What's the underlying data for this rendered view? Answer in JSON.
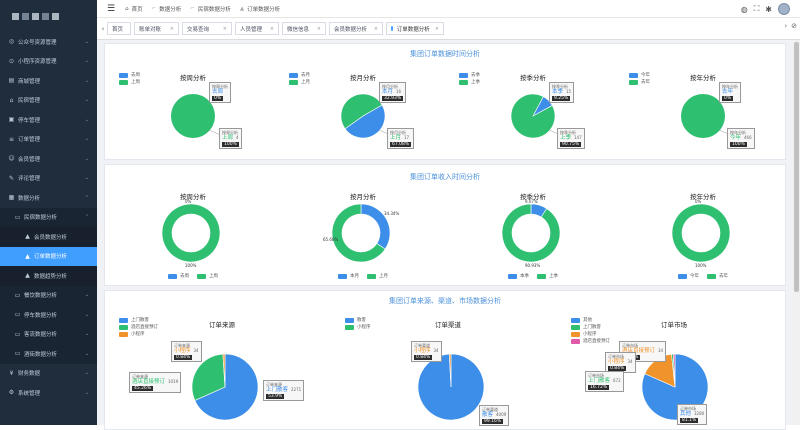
{
  "sidebar": {
    "items": [
      {
        "label": "公众号资源管理",
        "icon": "wechat-icon"
      },
      {
        "label": "小程序资源管理",
        "icon": "miniapp-icon"
      },
      {
        "label": "商城管理",
        "icon": "mall-icon"
      },
      {
        "label": "民宿管理",
        "icon": "homestay-icon"
      },
      {
        "label": "停车管理",
        "icon": "parking-icon"
      },
      {
        "label": "订单管理",
        "icon": "order-icon"
      },
      {
        "label": "会员管理",
        "icon": "member-icon"
      },
      {
        "label": "评论管理",
        "icon": "comment-icon"
      },
      {
        "label": "数据分析",
        "icon": "analysis-icon"
      },
      {
        "label": "民宿数据分析",
        "icon": "folder-icon"
      },
      {
        "label": "会员数据分析",
        "icon": "chart-icon"
      },
      {
        "label": "订单数据分析",
        "icon": "chart-icon"
      },
      {
        "label": "数据趋势分析",
        "icon": "chart-icon"
      },
      {
        "label": "餐饮数据分析",
        "icon": "folder-icon"
      },
      {
        "label": "停车数据分析",
        "icon": "folder-icon"
      },
      {
        "label": "客流数据分析",
        "icon": "folder-icon"
      },
      {
        "label": "酒街数据分析",
        "icon": "folder-icon"
      },
      {
        "label": "财务数据",
        "icon": "finance-icon"
      },
      {
        "label": "系统管理",
        "icon": "system-icon"
      }
    ]
  },
  "navbar": {
    "breadcrumb": [
      "首页",
      "数据分析",
      "民宿数据分析",
      "订单数据分析"
    ]
  },
  "tabs": [
    "首页",
    "账单对账",
    "交易查询",
    "人员管理",
    "微信信息",
    "会员数据分析",
    "订单数据分析"
  ],
  "colors": {
    "blue": "#3d8ee8",
    "green": "#2fbf71",
    "orange": "#f0932b",
    "pink": "#e05aa7",
    "sidebar": "#1f2d3d",
    "accent": "#409eff"
  },
  "sections": {
    "time_title": "集团订单数据时间分析",
    "income_title": "集团订单收入时间分析",
    "source_title": "集团订单来源、渠道、市场数据分析"
  },
  "time_charts": [
    {
      "title": "按周分析",
      "legend": [
        "去周",
        "上周"
      ],
      "tip1": {
        "label": "按周分析",
        "name": "去周",
        "pct": "0%"
      },
      "tip2": {
        "label": "按周分析",
        "name": "上周",
        "value": "4",
        "pct": "100%"
      }
    },
    {
      "title": "按月分析",
      "legend": [
        "去月",
        "上月"
      ],
      "tip1": {
        "label": "按月分析",
        "name": "本月",
        "value": "16",
        "pct": "32.93%"
      },
      "tip2": {
        "label": "按月分析",
        "name": "上月",
        "value": "17",
        "pct": "67.08%"
      }
    },
    {
      "title": "按季分析",
      "legend": [
        "去季",
        "上季"
      ],
      "tip1": {
        "label": "按季分析",
        "name": "本季",
        "value": "15",
        "pct": "9.25%"
      },
      "tip2": {
        "label": "按季分析",
        "name": "上季",
        "value": "147",
        "pct": "90.75%"
      }
    },
    {
      "title": "按年分析",
      "legend": [
        "今年",
        "去年"
      ],
      "tip1": {
        "label": "按年分析",
        "name": "去年",
        "pct": "0%"
      },
      "tip2": {
        "label": "按年分析",
        "name": "今年",
        "value": "466",
        "pct": "100%"
      }
    }
  ],
  "income_charts": [
    {
      "title": "按周分析",
      "legend": [
        "去周",
        "上周"
      ],
      "top_label": "0%",
      "bottom_label": "100%"
    },
    {
      "title": "按月分析",
      "legend": [
        "本月",
        "上月"
      ],
      "left_label": "65.66%",
      "right_label": "34.34%"
    },
    {
      "title": "按季分析",
      "legend": [
        "本季",
        "上季"
      ],
      "top_label": "9.07%",
      "bottom_label": "90.93%"
    },
    {
      "title": "按年分析",
      "legend": [
        "今年",
        "去年"
      ],
      "top_label": "0%",
      "bottom_label": "100%"
    }
  ],
  "source_charts": [
    {
      "title": "订单来源",
      "legend": [
        "上门散客",
        "酒店直接预订",
        "小程序"
      ],
      "tips": [
        {
          "label": "订单来源",
          "name": "小程序",
          "value": "34",
          "pct": "0.84%"
        },
        {
          "label": "订单来源",
          "name": "酒店直接预订",
          "value": "1019",
          "pct": "45.26%"
        },
        {
          "label": "订单来源",
          "name": "上门散客",
          "value": "2271",
          "pct": "53.9%"
        }
      ]
    },
    {
      "title": "订单渠道",
      "legend": [
        "散客",
        "小程序"
      ],
      "tips": [
        {
          "label": "订单渠道",
          "name": "小程序",
          "value": "34",
          "pct": "0.84%"
        },
        {
          "label": "订单渠道",
          "name": "散客",
          "value": "4009",
          "pct": "99.16%"
        }
      ]
    },
    {
      "title": "订单市场",
      "legend": [
        "其他",
        "上门散客",
        "小程序",
        "酒店直接预订"
      ],
      "tips": [
        {
          "label": "订单市场",
          "name": "酒店直接预订",
          "value": "34",
          "pct": "0.84%"
        },
        {
          "label": "订单市场",
          "name": "小程序",
          "value": "34",
          "pct": "0.84%"
        },
        {
          "label": "订单市场",
          "name": "上门散客",
          "value": "672",
          "pct": "16.72%"
        },
        {
          "label": "订单市场",
          "name": "其他",
          "value": "3280",
          "pct": "81.1%"
        }
      ]
    }
  ],
  "chart_data": [
    {
      "type": "pie",
      "title": "按周分析",
      "categories": [
        "去周",
        "上周"
      ],
      "values": [
        0,
        4
      ]
    },
    {
      "type": "pie",
      "title": "按月分析",
      "categories": [
        "本月",
        "上月"
      ],
      "values": [
        16,
        17
      ]
    },
    {
      "type": "pie",
      "title": "按季分析",
      "categories": [
        "本季",
        "上季"
      ],
      "values": [
        15,
        147
      ]
    },
    {
      "type": "pie",
      "title": "按年分析",
      "categories": [
        "去年",
        "今年"
      ],
      "values": [
        0,
        466
      ]
    },
    {
      "type": "pie",
      "title": "按周分析",
      "categories": [
        "去周",
        "上周"
      ],
      "values": [
        0,
        100
      ]
    },
    {
      "type": "pie",
      "title": "按月分析",
      "categories": [
        "本月",
        "上月"
      ],
      "values": [
        34.34,
        65.66
      ]
    },
    {
      "type": "pie",
      "title": "按季分析",
      "categories": [
        "本季",
        "上季"
      ],
      "values": [
        9.07,
        90.93
      ]
    },
    {
      "type": "pie",
      "title": "按年分析",
      "categories": [
        "去年",
        "今年"
      ],
      "values": [
        0,
        100
      ]
    },
    {
      "type": "pie",
      "title": "订单来源",
      "categories": [
        "上门散客",
        "酒店直接预订",
        "小程序"
      ],
      "values": [
        2271,
        1019,
        34
      ]
    },
    {
      "type": "pie",
      "title": "订单渠道",
      "categories": [
        "散客",
        "小程序"
      ],
      "values": [
        4009,
        34
      ]
    },
    {
      "type": "pie",
      "title": "订单市场",
      "categories": [
        "其他",
        "上门散客",
        "小程序",
        "酒店直接预订"
      ],
      "values": [
        3280,
        672,
        34,
        34
      ]
    }
  ]
}
